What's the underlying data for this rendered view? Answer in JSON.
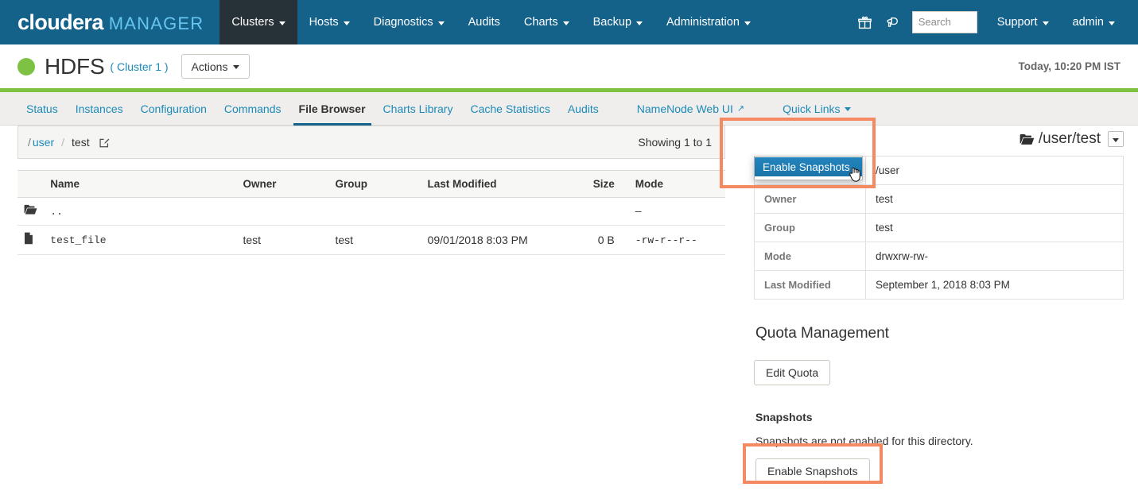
{
  "navbar": {
    "brand_primary": "cloudera",
    "brand_secondary": "MANAGER",
    "items": [
      {
        "label": "Clusters",
        "caret": true,
        "active": true
      },
      {
        "label": "Hosts",
        "caret": true,
        "active": false
      },
      {
        "label": "Diagnostics",
        "caret": true,
        "active": false
      },
      {
        "label": "Audits",
        "caret": false,
        "active": false
      },
      {
        "label": "Charts",
        "caret": true,
        "active": false
      },
      {
        "label": "Backup",
        "caret": true,
        "active": false
      },
      {
        "label": "Administration",
        "caret": true,
        "active": false
      }
    ],
    "gift_icon": "gift-icon",
    "announcement_icon": "announcement-icon",
    "search_placeholder": "Search",
    "search_value": "",
    "support_label": "Support",
    "admin_label": "admin",
    "background_color": "#14618a",
    "active_item_color": "#263238"
  },
  "titlebar": {
    "status": "good",
    "status_color": "#7dc242",
    "service_name": "HDFS",
    "cluster_label": "( Cluster 1 )",
    "actions_label": "Actions",
    "timestamp": "Today, 10:20 PM IST"
  },
  "tabs": [
    {
      "label": "Status",
      "active": false,
      "external": false,
      "caret": false,
      "spaced": false
    },
    {
      "label": "Instances",
      "active": false,
      "external": false,
      "caret": false,
      "spaced": false
    },
    {
      "label": "Configuration",
      "active": false,
      "external": false,
      "caret": false,
      "spaced": false
    },
    {
      "label": "Commands",
      "active": false,
      "external": false,
      "caret": false,
      "spaced": false
    },
    {
      "label": "File Browser",
      "active": true,
      "external": false,
      "caret": false,
      "spaced": false
    },
    {
      "label": "Charts Library",
      "active": false,
      "external": false,
      "caret": false,
      "spaced": false
    },
    {
      "label": "Cache Statistics",
      "active": false,
      "external": false,
      "caret": false,
      "spaced": false
    },
    {
      "label": "Audits",
      "active": false,
      "external": false,
      "caret": false,
      "spaced": false
    },
    {
      "label": "NameNode Web UI",
      "active": false,
      "external": true,
      "caret": false,
      "spaced": true
    },
    {
      "label": "Quick Links",
      "active": false,
      "external": false,
      "caret": true,
      "spaced": true
    }
  ],
  "breadcrumb": {
    "root": "/",
    "link": "user",
    "separator": "/",
    "current": "test",
    "edit_icon": "edit-pencil-icon",
    "showing": "Showing 1 to 1"
  },
  "file_table": {
    "headers": [
      "",
      "Name",
      "Owner",
      "Group",
      "Last Modified",
      "Size",
      "Mode"
    ],
    "rows": [
      {
        "icon": "folder-icon",
        "name": "..",
        "owner": "",
        "group": "",
        "modified": "",
        "size": "",
        "mode": "—"
      },
      {
        "icon": "file-icon",
        "name": "test_file",
        "owner": "test",
        "group": "test",
        "modified": "09/01/2018 8:03 PM",
        "size": "0 B",
        "mode": "-rw-r--r--"
      }
    ]
  },
  "detail_panel": {
    "folder_icon": "folder-icon",
    "path": "/user/test",
    "dropdown_icon": "chevron-down-icon",
    "rows": [
      {
        "key": "",
        "value": "/user"
      },
      {
        "key": "Owner",
        "value": "test"
      },
      {
        "key": "Group",
        "value": "test"
      },
      {
        "key": "Mode",
        "value": "drwxrw-rw-"
      },
      {
        "key": "Last Modified",
        "value": "September 1, 2018 8:03 PM"
      }
    ],
    "quota_title": "Quota Management",
    "edit_quota_label": "Edit Quota",
    "snapshots_title": "Snapshots",
    "snapshots_text": "Snapshots are not enabled for this directory.",
    "enable_snapshots_label": "Enable Snapshots"
  },
  "dropdown_menu": {
    "items": [
      {
        "label": "Enable Snapshots",
        "highlighted": true
      }
    ],
    "highlight_color": "#1a74a8",
    "cursor_icon": "hand-pointer-cursor"
  },
  "annotations": {
    "color": "#f58a62",
    "boxes": [
      {
        "name": "dropdown-menu-highlight"
      },
      {
        "name": "enable-snapshots-button-highlight"
      }
    ]
  }
}
